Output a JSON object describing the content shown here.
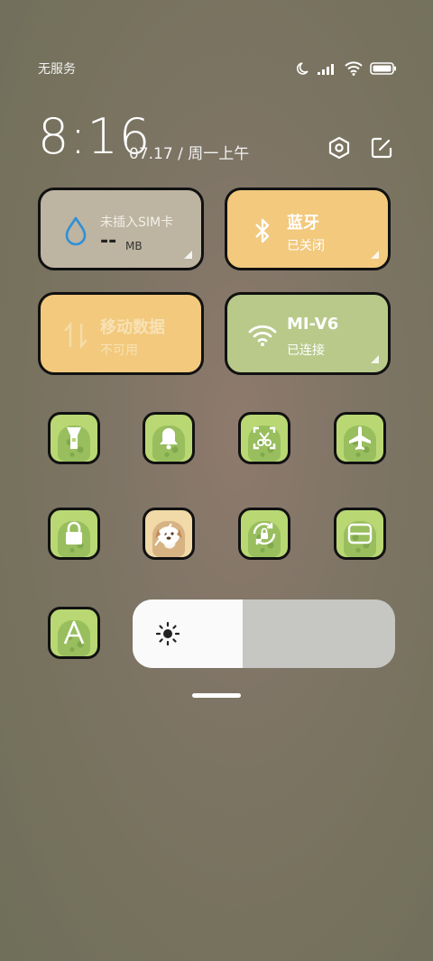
{
  "status_bar": {
    "carrier": "无服务"
  },
  "header": {
    "time": "8:16",
    "date": "07.17 / 周一上午"
  },
  "tiles": {
    "data_usage": {
      "title": "未插入SIM卡",
      "value": "--",
      "unit": "MB"
    },
    "bluetooth": {
      "title": "蓝牙",
      "subtitle": "已关闭"
    },
    "mobile_data": {
      "title": "移动数据",
      "subtitle": "不可用"
    },
    "wifi": {
      "title": "MI-V6",
      "subtitle": "已连接"
    }
  },
  "brightness": {
    "level": 0.42
  },
  "colors": {
    "grey_tile": "#bdb4a2",
    "orange_tile": "#f2c97d",
    "green_tile": "#b8c98a",
    "toggle_green": "#b9d874",
    "water_blue": "#2f90d6"
  },
  "icons": [
    "moon-icon",
    "signal-icon",
    "wifi-icon",
    "battery-icon",
    "settings-icon",
    "edit-icon",
    "water-drop-icon",
    "bluetooth-icon",
    "mobile-data-icon",
    "flashlight-icon",
    "bell-icon",
    "screenshot-icon",
    "airplane-icon",
    "lock-icon",
    "rotation-lock-icon",
    "reading-mode-icon",
    "auto-brightness-icon",
    "sun-icon"
  ]
}
